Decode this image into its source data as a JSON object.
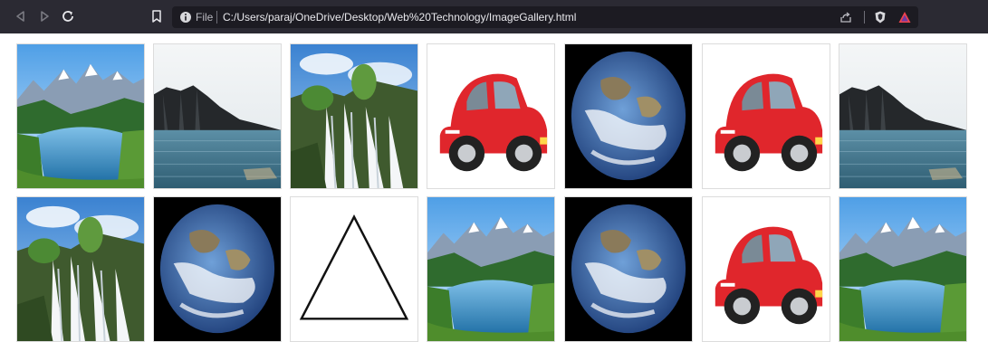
{
  "browser": {
    "file_label": "File",
    "url": "C:/Users/paraj/OneDrive/Desktop/Web%20Technology/ImageGallery.html"
  },
  "gallery": {
    "rows": [
      [
        "lake",
        "cliff",
        "waterfall",
        "car",
        "earth",
        "car",
        "cliff"
      ],
      [
        "waterfall",
        "earth",
        "triangle",
        "lake",
        "earth",
        "car",
        "lake"
      ]
    ]
  },
  "icons": [
    "back-icon",
    "forward-icon",
    "reload-icon",
    "bookmark-icon",
    "info-icon",
    "share-icon",
    "brave-shield-icon",
    "brave-rewards-icon"
  ]
}
